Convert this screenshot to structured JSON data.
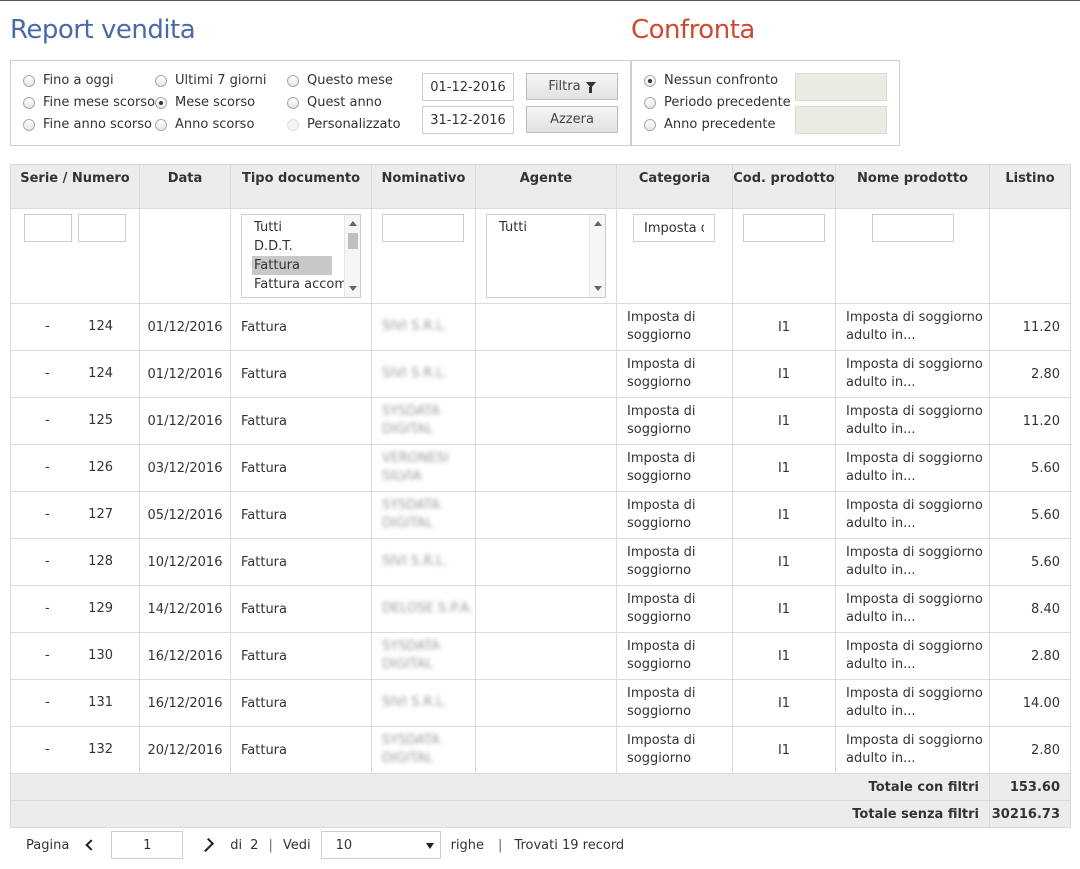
{
  "titles": {
    "report": "Report vendita",
    "compare": "Confronta"
  },
  "periods": [
    {
      "label": "Fino a oggi",
      "checked": false,
      "disabled": false
    },
    {
      "label": "Fine mese scorso",
      "checked": false,
      "disabled": false
    },
    {
      "label": "Fine anno scorso",
      "checked": false,
      "disabled": false
    },
    {
      "label": "Ultimi 7 giorni",
      "checked": false,
      "disabled": false
    },
    {
      "label": "Mese scorso",
      "checked": true,
      "disabled": false
    },
    {
      "label": "Anno scorso",
      "checked": false,
      "disabled": false
    },
    {
      "label": "Questo mese",
      "checked": false,
      "disabled": false
    },
    {
      "label": "Quest anno",
      "checked": false,
      "disabled": false
    },
    {
      "label": "Personalizzato",
      "checked": false,
      "disabled": true
    }
  ],
  "dates": {
    "from": "01-12-2016",
    "to": "31-12-2016"
  },
  "buttons": {
    "filter": "Filtra",
    "reset": "Azzera"
  },
  "compare": [
    {
      "label": "Nessun confronto",
      "checked": true
    },
    {
      "label": "Periodo precedente",
      "checked": false
    },
    {
      "label": "Anno precedente",
      "checked": false
    }
  ],
  "columns": [
    "Serie / Numero",
    "Data",
    "Tipo documento",
    "Nominativo",
    "Agente",
    "Categoria",
    "Cod. prodotto",
    "Nome prodotto",
    "Listino"
  ],
  "filters": {
    "tipo_options": [
      "Tutti",
      "D.D.T.",
      "Fattura",
      "Fattura accom"
    ],
    "tipo_selected": "Fattura",
    "agente_options": [
      "Tutti"
    ],
    "categoria_value": "Imposta c"
  },
  "rows": [
    {
      "serie": "-",
      "numero": "124",
      "data": "01/12/2016",
      "tipo": "Fattura",
      "nominativo": "SIVI S.R.L.",
      "agente": "",
      "categoria": "Imposta di soggiorno",
      "cod": "I1",
      "nome": "Imposta di soggiorno adulto in...",
      "listino": "11.20"
    },
    {
      "serie": "-",
      "numero": "124",
      "data": "01/12/2016",
      "tipo": "Fattura",
      "nominativo": "SIVI S.R.L.",
      "agente": "",
      "categoria": "Imposta di soggiorno",
      "cod": "I1",
      "nome": "Imposta di soggiorno adulto in...",
      "listino": "2.80"
    },
    {
      "serie": "-",
      "numero": "125",
      "data": "01/12/2016",
      "tipo": "Fattura",
      "nominativo": "SYSDATA DIGITAL",
      "agente": "",
      "categoria": "Imposta di soggiorno",
      "cod": "I1",
      "nome": "Imposta di soggiorno adulto in...",
      "listino": "11.20"
    },
    {
      "serie": "-",
      "numero": "126",
      "data": "03/12/2016",
      "tipo": "Fattura",
      "nominativo": "VERONESI SILVIA",
      "agente": "",
      "categoria": "Imposta di soggiorno",
      "cod": "I1",
      "nome": "Imposta di soggiorno adulto in...",
      "listino": "5.60"
    },
    {
      "serie": "-",
      "numero": "127",
      "data": "05/12/2016",
      "tipo": "Fattura",
      "nominativo": "SYSDATA DIGITAL",
      "agente": "",
      "categoria": "Imposta di soggiorno",
      "cod": "I1",
      "nome": "Imposta di soggiorno adulto in...",
      "listino": "5.60"
    },
    {
      "serie": "-",
      "numero": "128",
      "data": "10/12/2016",
      "tipo": "Fattura",
      "nominativo": "SIVI S.R.L.",
      "agente": "",
      "categoria": "Imposta di soggiorno",
      "cod": "I1",
      "nome": "Imposta di soggiorno adulto in...",
      "listino": "5.60"
    },
    {
      "serie": "-",
      "numero": "129",
      "data": "14/12/2016",
      "tipo": "Fattura",
      "nominativo": "DELOSE S.P.A.",
      "agente": "",
      "categoria": "Imposta di soggiorno",
      "cod": "I1",
      "nome": "Imposta di soggiorno adulto in...",
      "listino": "8.40"
    },
    {
      "serie": "-",
      "numero": "130",
      "data": "16/12/2016",
      "tipo": "Fattura",
      "nominativo": "SYSDATA DIGITAL",
      "agente": "",
      "categoria": "Imposta di soggiorno",
      "cod": "I1",
      "nome": "Imposta di soggiorno adulto in...",
      "listino": "2.80"
    },
    {
      "serie": "-",
      "numero": "131",
      "data": "16/12/2016",
      "tipo": "Fattura",
      "nominativo": "SIVI S.R.L.",
      "agente": "",
      "categoria": "Imposta di soggiorno",
      "cod": "I1",
      "nome": "Imposta di soggiorno adulto in...",
      "listino": "14.00"
    },
    {
      "serie": "-",
      "numero": "132",
      "data": "20/12/2016",
      "tipo": "Fattura",
      "nominativo": "SYSDATA DIGITAL",
      "agente": "",
      "categoria": "Imposta di soggiorno",
      "cod": "I1",
      "nome": "Imposta di soggiorno adulto in...",
      "listino": "2.80"
    }
  ],
  "totals": {
    "filtered_label": "Totale con filtri",
    "filtered_value": "153.60",
    "unfiltered_label": "Totale senza filtri",
    "unfiltered_value": "30216.73"
  },
  "pager": {
    "page_label": "Pagina",
    "page": "1",
    "of_label": "di",
    "pages": "2",
    "sep": "|",
    "show_label": "Vedi",
    "per_page": "10",
    "rows_label": "righe",
    "found": "Trovati 19 record"
  }
}
